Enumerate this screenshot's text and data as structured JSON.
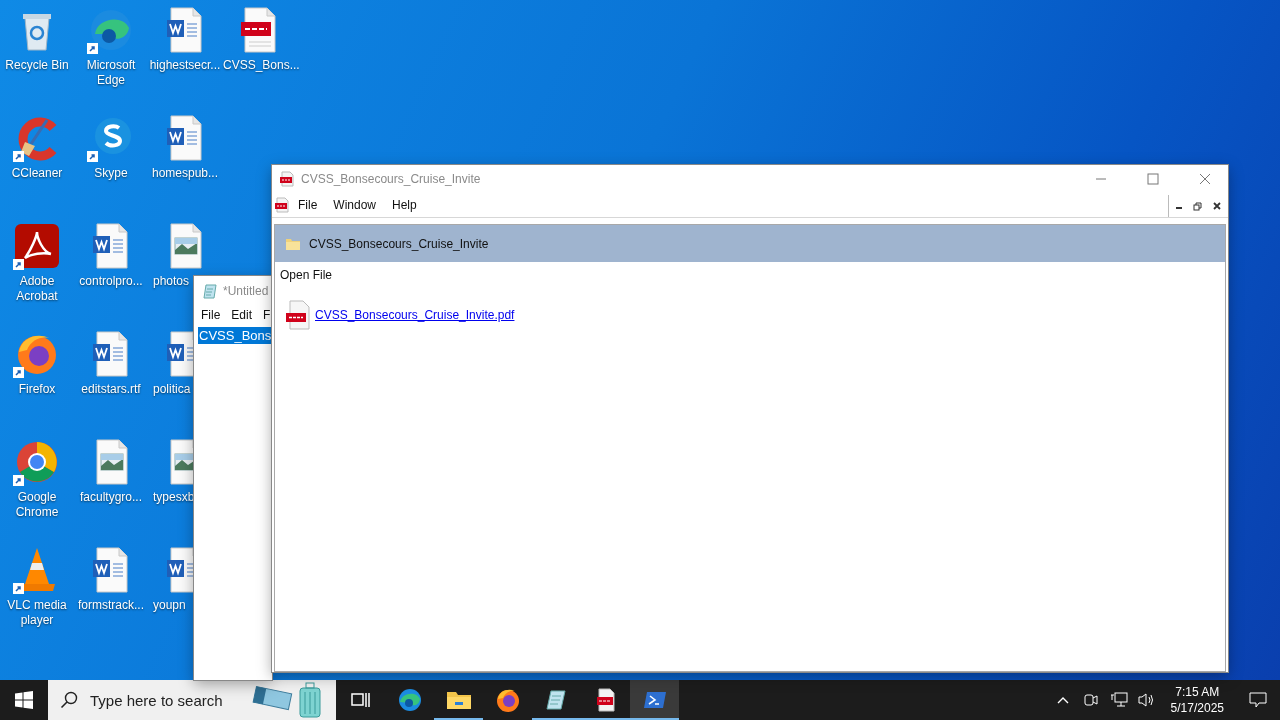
{
  "desktop_icons": [
    {
      "label": "Recycle Bin",
      "kind": "recycle",
      "shortcut": false,
      "cut": false
    },
    {
      "label": "CCleaner",
      "kind": "ccleaner",
      "shortcut": true,
      "cut": false
    },
    {
      "label": "Adobe Acrobat",
      "kind": "acrobat",
      "shortcut": true,
      "cut": false
    },
    {
      "label": "Firefox",
      "kind": "firefox",
      "shortcut": true,
      "cut": false
    },
    {
      "label": "Google Chrome",
      "kind": "chrome",
      "shortcut": true,
      "cut": false
    },
    {
      "label": "VLC media player",
      "kind": "vlc",
      "shortcut": true,
      "cut": false
    },
    {
      "label": "Microsoft Edge",
      "kind": "edge",
      "shortcut": true,
      "cut": false
    },
    {
      "label": "Skype",
      "kind": "skype",
      "shortcut": true,
      "cut": false
    },
    {
      "label": "controlpro...",
      "kind": "word",
      "shortcut": false,
      "cut": false
    },
    {
      "label": "editstars.rtf",
      "kind": "word",
      "shortcut": false,
      "cut": false
    },
    {
      "label": "facultygro...",
      "kind": "image",
      "shortcut": false,
      "cut": false
    },
    {
      "label": "formstrack...",
      "kind": "word",
      "shortcut": false,
      "cut": false
    },
    {
      "label": "highestsecr...",
      "kind": "word",
      "shortcut": false,
      "cut": false
    },
    {
      "label": "homespub...",
      "kind": "word",
      "shortcut": false,
      "cut": false
    },
    {
      "label": "photos",
      "kind": "image",
      "shortcut": false,
      "cut": true
    },
    {
      "label": "politica",
      "kind": "word",
      "shortcut": false,
      "cut": true
    },
    {
      "label": "typesxb",
      "kind": "image",
      "shortcut": false,
      "cut": true
    },
    {
      "label": "youpn",
      "kind": "word",
      "shortcut": false,
      "cut": true
    },
    {
      "label": "CVSS_Bons...",
      "kind": "pdf",
      "shortcut": false,
      "cut": false
    }
  ],
  "notepad": {
    "title": "*Untitled",
    "menu": [
      "File",
      "Edit",
      "F"
    ],
    "selected_text": "CVSS_Bons"
  },
  "viewer": {
    "title": "CVSS_Bonsecours_Cruise_Invite",
    "menu": [
      "File",
      "Window",
      "Help"
    ],
    "folder": "CVSS_Bonsecours_Cruise_Invite",
    "section": "Open File",
    "file_link": "CVSS_Bonsecours_Cruise_Invite.pdf"
  },
  "taskbar": {
    "search": {
      "placeholder": "Type here to search"
    },
    "apps": [
      {
        "kind": "taskview",
        "running": false,
        "active": false
      },
      {
        "kind": "edge",
        "running": false,
        "active": false
      },
      {
        "kind": "explorer",
        "running": true,
        "active": false
      },
      {
        "kind": "firefox",
        "running": false,
        "active": false
      },
      {
        "kind": "notepad",
        "running": true,
        "active": false
      },
      {
        "kind": "pdf",
        "running": true,
        "active": false
      },
      {
        "kind": "powershell",
        "running": true,
        "active": true
      }
    ],
    "time": "7:15 AM",
    "date": "5/17/2025"
  }
}
